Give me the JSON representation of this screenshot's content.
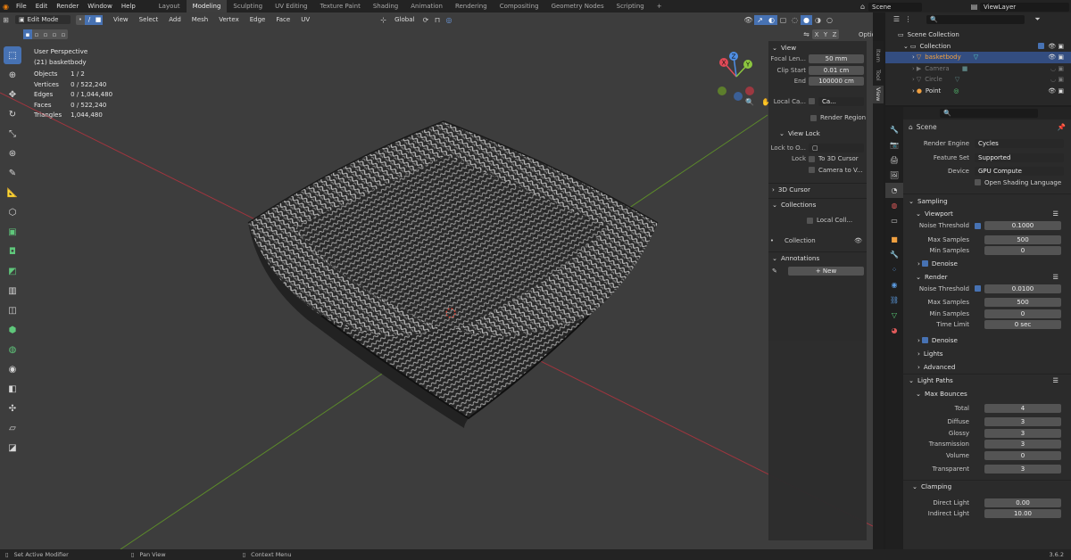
{
  "topbar": {
    "menus": [
      "File",
      "Edit",
      "Render",
      "Window",
      "Help"
    ],
    "workspaces": [
      "Layout",
      "Modeling",
      "Sculpting",
      "UV Editing",
      "Texture Paint",
      "Shading",
      "Animation",
      "Rendering",
      "Compositing",
      "Geometry Nodes",
      "Scripting"
    ],
    "active_workspace": "Modeling",
    "add_tab": "+",
    "scene": "Scene",
    "view_layer": "ViewLayer"
  },
  "viewport_header": {
    "mode": "Edit Mode",
    "menus": [
      "View",
      "Select",
      "Add",
      "Mesh",
      "Vertex",
      "Edge",
      "Face",
      "UV"
    ],
    "transform_orientation": "Global",
    "options": "Options",
    "axes": [
      "X",
      "Y",
      "Z"
    ]
  },
  "overlay": {
    "view_name": "User Perspective",
    "object_name": "(21) basketbody",
    "stats": [
      {
        "label": "Objects",
        "value": "1 / 2"
      },
      {
        "label": "Vertices",
        "value": "0 / 522,240"
      },
      {
        "label": "Edges",
        "value": "0 / 1,044,480"
      },
      {
        "label": "Faces",
        "value": "0 / 522,240"
      },
      {
        "label": "Triangles",
        "value": "1,044,480"
      }
    ]
  },
  "gizmo": {
    "x": "X",
    "y": "Y",
    "z": "Z"
  },
  "npanel": {
    "view_header": "View",
    "focal_length_label": "Focal Len...",
    "focal_length": "50 mm",
    "clip_start_label": "Clip Start",
    "clip_start": "0.01 cm",
    "clip_end_label": "End",
    "clip_end": "100000 cm",
    "local_camera_label": "Local Ca...",
    "local_camera_value": "Ca...",
    "render_region": "Render Region",
    "view_lock_header": "View Lock",
    "lock_to_object_label": "Lock to O...",
    "lock_label": "Lock",
    "lock_3d_cursor": "To 3D Cursor",
    "camera_to_view": "Camera to V...",
    "cursor_header": "3D Cursor",
    "collections_header": "Collections",
    "local_collections": "Local Coll...",
    "collection_item": "Collection",
    "annotations_header": "Annotations",
    "new_button": "New",
    "tabs": [
      "Item",
      "Tool",
      "View"
    ]
  },
  "outliner": {
    "search_placeholder": "",
    "items": [
      {
        "label": "Scene Collection",
        "indent": 0
      },
      {
        "label": "Collection",
        "indent": 1
      },
      {
        "label": "basketbody",
        "indent": 2,
        "selected": true
      },
      {
        "label": "Camera",
        "indent": 2
      },
      {
        "label": "Circle",
        "indent": 2
      },
      {
        "label": "Point",
        "indent": 2
      }
    ]
  },
  "properties": {
    "breadcrumb": "Scene",
    "render_engine_label": "Render Engine",
    "render_engine": "Cycles",
    "feature_set_label": "Feature Set",
    "feature_set": "Supported",
    "device_label": "Device",
    "device": "GPU Compute",
    "osl": "Open Shading Language",
    "sampling": "Sampling",
    "viewport": "Viewport",
    "noise_threshold_label": "Noise Threshold",
    "vp_noise_threshold": "0.1000",
    "max_samples_label": "Max Samples",
    "vp_max_samples": "500",
    "min_samples_label": "Min Samples",
    "vp_min_samples": "0",
    "denoise": "Denoise",
    "render": "Render",
    "r_noise_threshold": "0.0100",
    "r_max_samples": "500",
    "r_min_samples": "0",
    "time_limit_label": "Time Limit",
    "time_limit": "0 sec",
    "lights": "Lights",
    "advanced": "Advanced",
    "light_paths": "Light Paths",
    "max_bounces": "Max Bounces",
    "total_label": "Total",
    "total": "4",
    "diffuse_label": "Diffuse",
    "diffuse": "3",
    "glossy_label": "Glossy",
    "glossy": "3",
    "transmission_label": "Transmission",
    "transmission": "3",
    "volume_label": "Volume",
    "volume": "0",
    "transparent_label": "Transparent",
    "transparent": "3",
    "clamping": "Clamping",
    "direct_light_label": "Direct Light",
    "direct_light": "0.00",
    "indirect_light_label": "Indirect Light",
    "indirect_light": "10.00"
  },
  "status": {
    "left": "Set Active Modifier",
    "middle": "Pan View",
    "right": "Context Menu",
    "version": "3.6.2"
  },
  "colors": {
    "accent": "#4772b3",
    "x_axis": "#e04a57",
    "y_axis": "#8cc63f",
    "z_axis": "#4f8fe6",
    "viewport_bg": "#3d3d3d"
  }
}
